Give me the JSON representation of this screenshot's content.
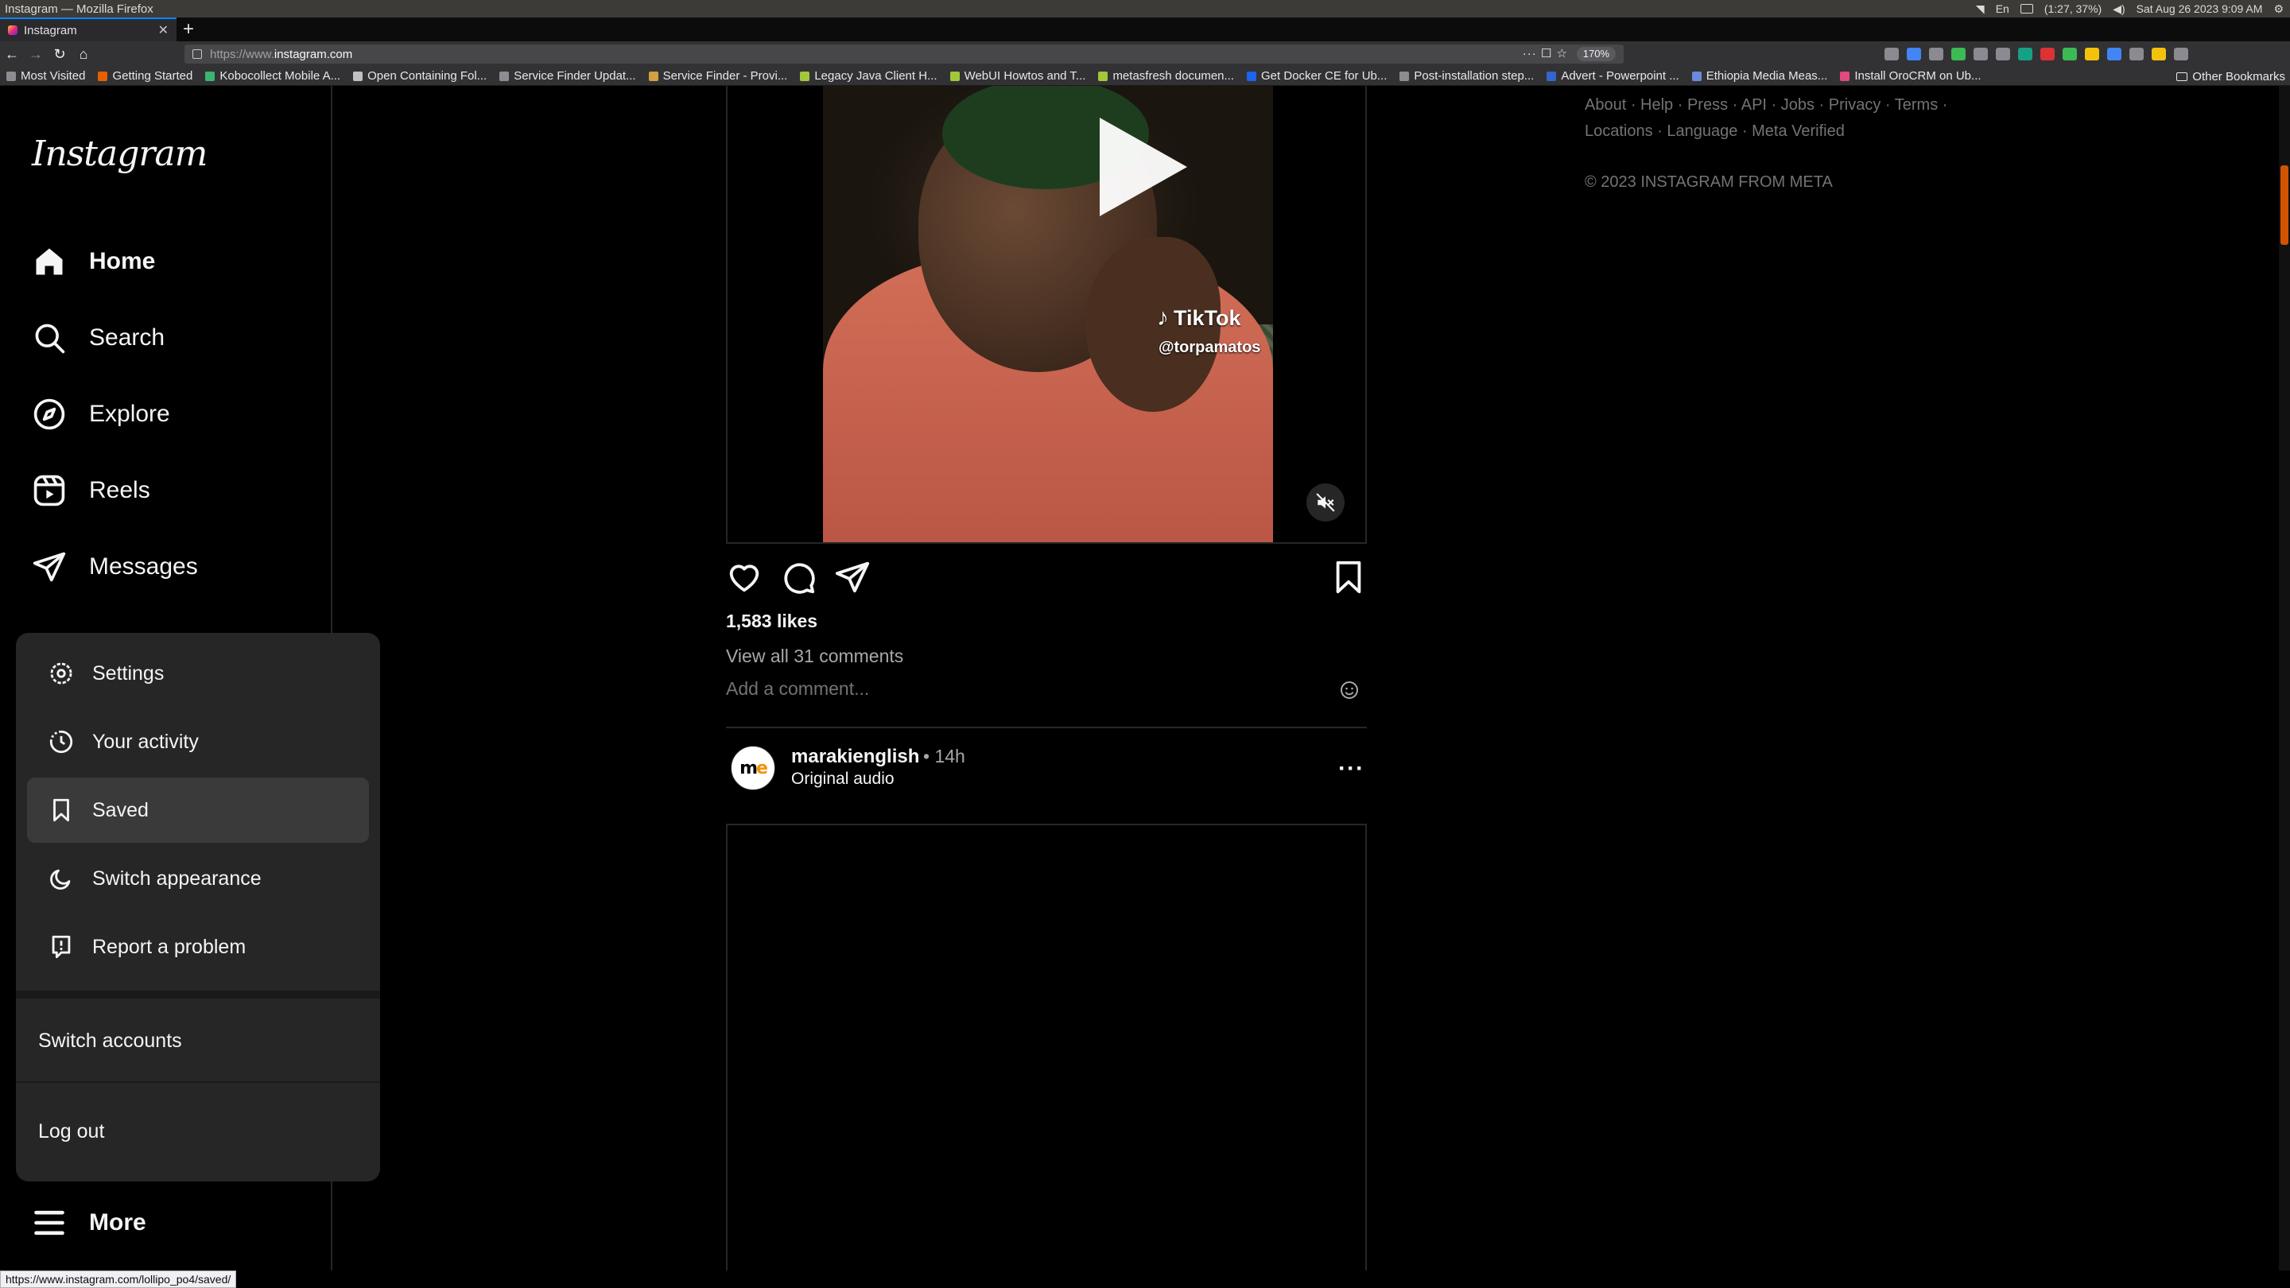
{
  "os": {
    "window_title": "Instagram — Mozilla Firefox",
    "tray_lang": "En",
    "tray_battery": "(1:27, 37%)",
    "tray_datetime": "Sat Aug 26 2023 9:09 AM"
  },
  "browser": {
    "tab_title": "Instagram",
    "url_proto": "https://www.",
    "url_host": "instagram.com",
    "zoom": "170%",
    "bookmarks": [
      "Most Visited",
      "Getting Started",
      "Kobocollect Mobile A...",
      "Open Containing Fol...",
      "Service Finder Updat...",
      "Service Finder - Provi...",
      "Legacy Java Client H...",
      "WebUI Howtos and T...",
      "metasfresh documen...",
      "Get Docker CE for Ub...",
      "Post-installation step...",
      "Advert - Powerpoint ...",
      "Ethiopia Media Meas...",
      "Install OroCRM on Ub..."
    ],
    "other_bookmarks": "Other Bookmarks",
    "status_url": "https://www.instagram.com/lollipo_po4/saved/"
  },
  "sidebar": {
    "logo": "Instagram",
    "items": [
      {
        "label": "Home"
      },
      {
        "label": "Search"
      },
      {
        "label": "Explore"
      },
      {
        "label": "Reels"
      },
      {
        "label": "Messages"
      }
    ],
    "more_label": "More"
  },
  "more_menu": {
    "items": [
      {
        "label": "Settings"
      },
      {
        "label": "Your activity"
      },
      {
        "label": "Saved"
      },
      {
        "label": "Switch appearance"
      },
      {
        "label": "Report a problem"
      }
    ],
    "switch_accounts": "Switch accounts",
    "log_out": "Log out"
  },
  "post1": {
    "watermark_brand": "TikTok",
    "watermark_handle": "@torpamatos",
    "likes": "1,583 likes",
    "view_comments": "View all 31 comments",
    "comment_placeholder": "Add a comment..."
  },
  "post2": {
    "username": "marakienglish",
    "time": "• 14h",
    "audio": "Original audio"
  },
  "footer": {
    "links_line1": "About · Help · Press · API · Jobs · Privacy · Terms ·",
    "links_line2": "Locations · Language · Meta Verified",
    "copyright": "© 2023 INSTAGRAM FROM META"
  },
  "colors": {
    "background": "#000000",
    "menu_bg": "#262626",
    "selected_bg": "#3a3a3a",
    "secondary_text": "#a8a8a8",
    "muted_text": "#737373"
  }
}
